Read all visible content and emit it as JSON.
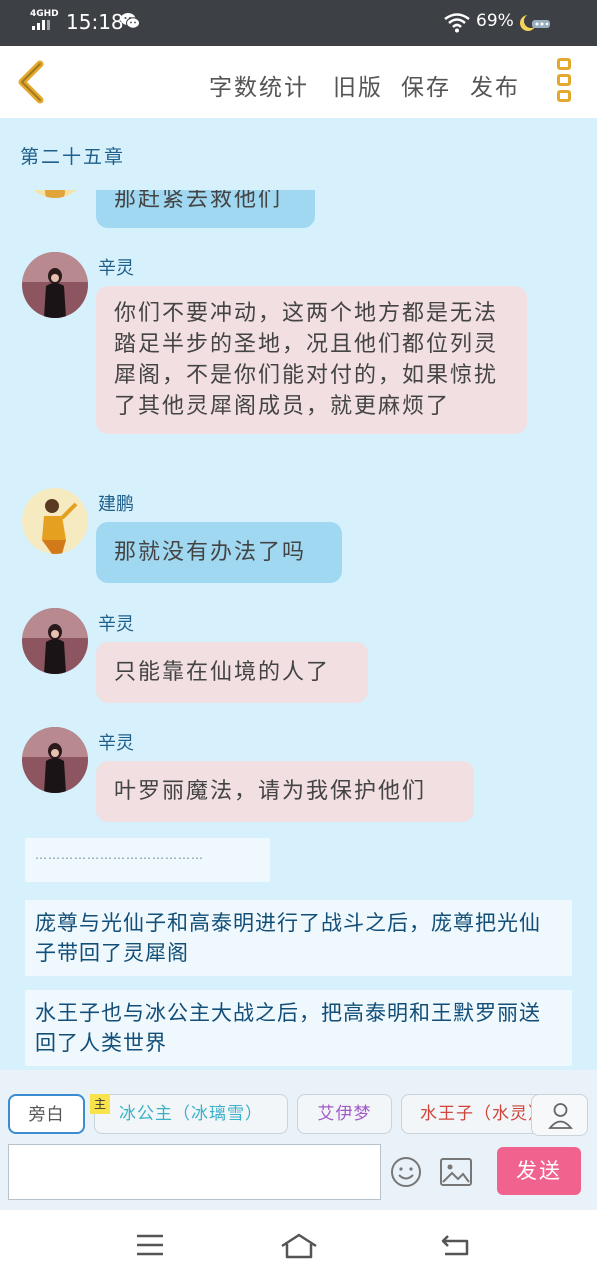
{
  "status_bar": {
    "network": "4GHD",
    "time": "15:18",
    "battery": "69%",
    "icons": [
      "wechat-icon",
      "wifi-icon",
      "moon-icon"
    ]
  },
  "toolbar": {
    "word_count": "字数统计",
    "old_version": "旧版",
    "save": "保存",
    "publish": "发布"
  },
  "chapter_title": "第二十五章",
  "messages": [
    {
      "sender": "",
      "text": "那赶紧去救他们",
      "style": "blue"
    },
    {
      "sender": "辛灵",
      "text": "你们不要冲动，这两个地方都是无法踏足半步的圣地，况且他们都位列灵犀阁，不是你们能对付的，如果惊扰了其他灵犀阁成员，就更麻烦了",
      "style": "pink"
    },
    {
      "sender": "建鹏",
      "text": "那就没有办法了吗",
      "style": "blue"
    },
    {
      "sender": "辛灵",
      "text": "只能靠在仙境的人了",
      "style": "pink"
    },
    {
      "sender": "辛灵",
      "text": "叶罗丽魔法，请为我保护他们",
      "style": "pink"
    }
  ],
  "narrations": [
    "…………………………………",
    "庞尊与光仙子和高泰明进行了战斗之后，庞尊把光仙子带回了灵犀阁",
    "水王子也与冰公主大战之后，把高泰明和王默罗丽送回了人类世界"
  ],
  "role_chips": [
    {
      "label": "旁白",
      "color": "#555555",
      "selected": true
    },
    {
      "label": "冰公主（冰璃雪）",
      "color": "#3bb0c8",
      "badge": "主"
    },
    {
      "label": "艾伊梦",
      "color": "#a25ac8"
    },
    {
      "label": "水王子（水灵）",
      "color": "#d0433a"
    }
  ],
  "input": {
    "placeholder": "",
    "send_label": "发送"
  }
}
